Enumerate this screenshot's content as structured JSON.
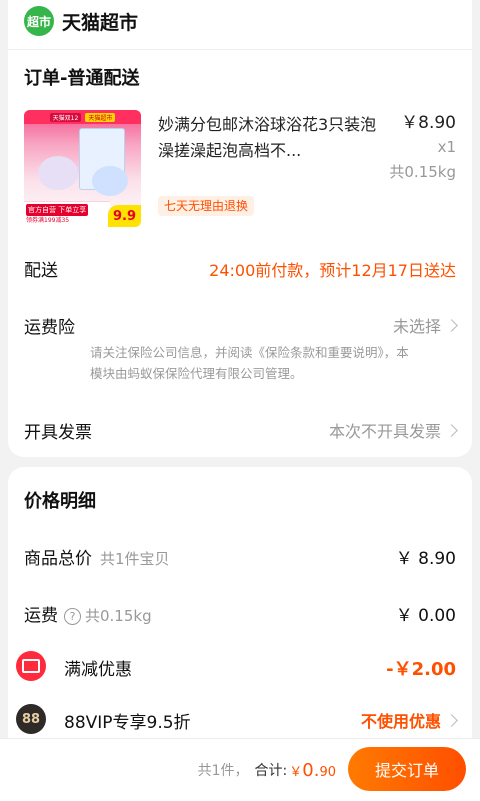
{
  "store": {
    "logo_text": "超市",
    "name": "天猫超市",
    "logo_color": "#35b54a"
  },
  "order": {
    "title": "订单-普通配送",
    "product": {
      "title": "妙满分包邮沐浴球浴花3只装泡澡搓澡起泡高档不...",
      "price": "￥8.90",
      "qty": "x1",
      "weight": "共0.15kg",
      "return_tag": "七天无理由退换",
      "image_text": {
        "tag1": "天猫双12",
        "tag2": "天猫超市",
        "bar_a": "官方自营 下单立享",
        "bar_b": "领券满199减35",
        "price": "9.9"
      }
    },
    "delivery": {
      "label": "配送",
      "value": "24:00前付款，预计12月17日送达"
    },
    "insurance": {
      "label": "运费险",
      "value": "未选择",
      "note": "请关注保险公司信息，并阅读《保险条款和重要说明》，本模块由蚂蚁保保险代理有限公司管理。"
    },
    "invoice": {
      "label": "开具发票",
      "value": "本次不开具发票"
    }
  },
  "price_detail": {
    "title": "价格明细",
    "goods_total": {
      "label": "商品总价",
      "note": "共1件宝贝",
      "value": "￥ 8.90"
    },
    "shipping": {
      "label": "运费",
      "note": "共0.15kg",
      "help": "?",
      "value": "￥ 0.00"
    },
    "discount": {
      "label": "满减优惠",
      "value": "-￥2.00"
    },
    "vip": {
      "label": "88VIP专享9.5折",
      "icon_text": "88",
      "value": "不使用优惠"
    }
  },
  "footer": {
    "count": "共1件，",
    "total_label": "合计:",
    "currency": "￥",
    "amount_int": "0.",
    "amount_dec": "90",
    "submit": "提交订单"
  },
  "colors": {
    "accent": "#ff5000",
    "background": "#f2f2f2"
  }
}
